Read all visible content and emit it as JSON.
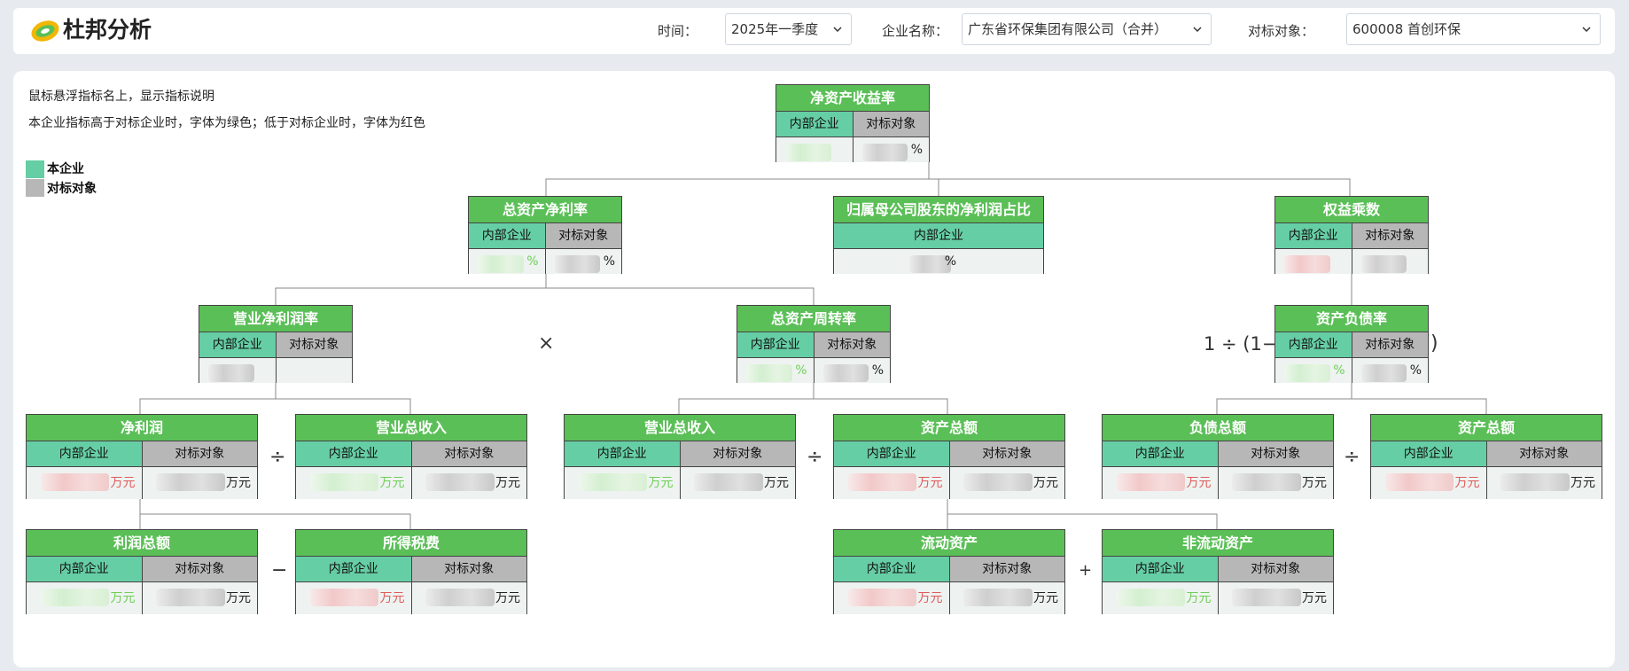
{
  "header": {
    "title": "杜邦分析",
    "time_label": "时间：",
    "time_value": "2025年一季度",
    "company_label": "企业名称：",
    "company_value": "广东省环保集团有限公司（合并）",
    "benchmark_label": "对标对象：",
    "benchmark_value": "600008 首创环保"
  },
  "notes": {
    "hover_hint": "鼠标悬浮指标名上，显示指标说明",
    "color_rule": "本企业指标高于对标企业时，字体为绿色；低于对标企业时，字体为红色"
  },
  "legend": {
    "own": "本企业",
    "bench": "对标对象",
    "own_color": "#66cea5",
    "bench_color": "#b7b7b7"
  },
  "labels": {
    "own": "内部企业",
    "bench": "对标对象"
  },
  "colors": {
    "title_bg": "#5bbf57",
    "good": "#6fcf57",
    "bad": "#e05b5b"
  },
  "nodes": {
    "roe": {
      "title": "净资产收益率",
      "own_unit": "",
      "bench_unit": "%"
    },
    "roa": {
      "title": "总资产净利率",
      "own_unit": "%",
      "bench_unit": "%"
    },
    "parent_ratio": {
      "title": "归属母公司股东的净利润占比",
      "own_unit": "%"
    },
    "equity_mult": {
      "title": "权益乘数",
      "own_unit": "",
      "bench_unit": ""
    },
    "net_margin": {
      "title": "营业净利润率",
      "own_unit": "",
      "bench_unit": ""
    },
    "asset_turnover": {
      "title": "总资产周转率",
      "own_unit": "%",
      "bench_unit": "%"
    },
    "debt_ratio": {
      "title": "资产负债率",
      "own_unit": "%",
      "bench_unit": "%"
    },
    "net_profit": {
      "title": "净利润",
      "own_unit": "万元",
      "bench_unit": "万元"
    },
    "revenue_a": {
      "title": "营业总收入",
      "own_unit": "万元",
      "bench_unit": "万元"
    },
    "revenue_b": {
      "title": "营业总收入",
      "own_unit": "万元",
      "bench_unit": "万元"
    },
    "total_assets_a": {
      "title": "资产总额",
      "own_unit": "万元",
      "bench_unit": "万元"
    },
    "total_liab": {
      "title": "负债总额",
      "own_unit": "万元",
      "bench_unit": "万元"
    },
    "total_assets_b": {
      "title": "资产总额",
      "own_unit": "万元",
      "bench_unit": "万元"
    },
    "total_profit": {
      "title": "利润总额",
      "own_unit": "万元",
      "bench_unit": "万元"
    },
    "income_tax": {
      "title": "所得税费",
      "own_unit": "万元",
      "bench_unit": "万元"
    },
    "current_assets": {
      "title": "流动资产",
      "own_unit": "万元",
      "bench_unit": "万元"
    },
    "noncurrent_assets": {
      "title": "非流动资产",
      "own_unit": "万元",
      "bench_unit": "万元"
    }
  },
  "operators": {
    "times": "×",
    "divide": "÷",
    "minus": "−",
    "plus": "+",
    "inv_prefix": "1 ÷ (1−",
    "inv_suffix": ")"
  }
}
